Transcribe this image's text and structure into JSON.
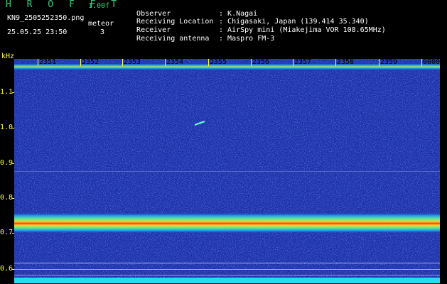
{
  "header": {
    "app_title": "H R O F F T",
    "version": "1.00f",
    "filename": "KN9_2505252350.png",
    "datetime": "25.05.25 23:50",
    "meteor_label": "meteor",
    "meteor_count": "3"
  },
  "info": [
    {
      "key": "Observer",
      "value": "K.Nagai"
    },
    {
      "key": "Receiving Location",
      "value": "Chigasaki, Japan (139.414 35.340)"
    },
    {
      "key": "Receiver",
      "value": "AirSpy mini (Miakejima VOR 108.65MHz)"
    },
    {
      "key": "Receiving antenna",
      "value": "Maspro FM-3"
    }
  ],
  "axis": {
    "y_unit": "kHz",
    "y_ticks": [
      "1.1",
      "1.0",
      "0.9",
      "0.8",
      "0.7",
      "0.6"
    ],
    "x_ticks": [
      "2351",
      "2352",
      "2353",
      "2354",
      "2355",
      "2356",
      "2357",
      "2358",
      "2359",
      "0000"
    ]
  },
  "colors": {
    "background": "#000000",
    "accent_green": "#33d17a",
    "axis_yellow": "#ffff44",
    "plot_noise": "#1a2ea8",
    "signal_band": "#ff3322"
  }
}
